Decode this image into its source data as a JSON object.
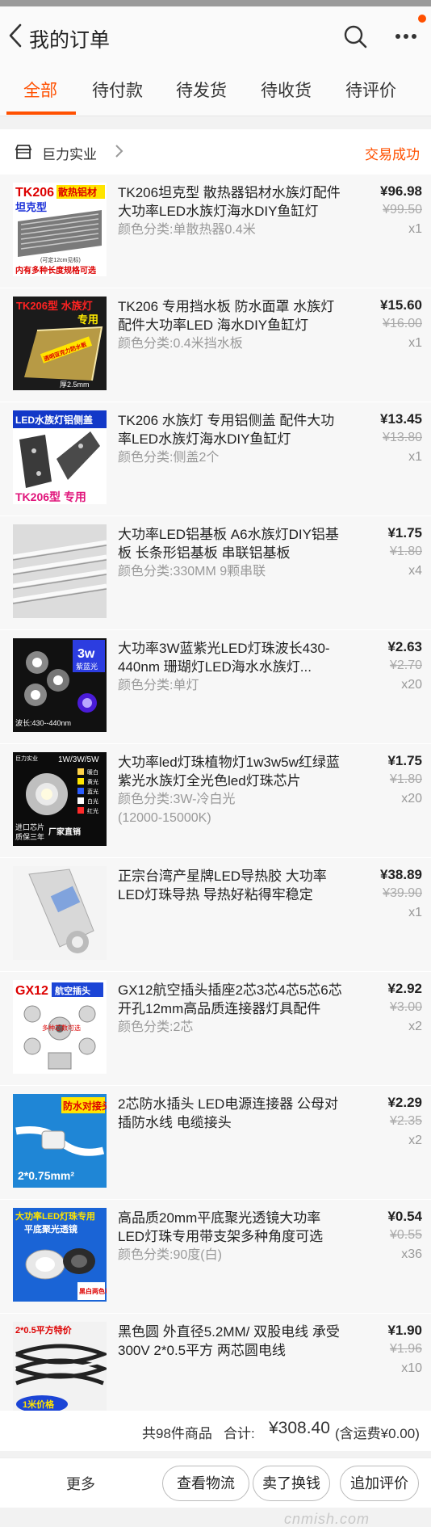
{
  "header": {
    "title": "我的订单"
  },
  "tabs": [
    {
      "label": "全部",
      "active": true
    },
    {
      "label": "待付款"
    },
    {
      "label": "待发货"
    },
    {
      "label": "待收货"
    },
    {
      "label": "待评价"
    }
  ],
  "shop": {
    "name": "巨力实业",
    "status": "交易成功"
  },
  "items": [
    {
      "name": "TK206坦克型 散热器铝材水族灯配件大功率LED水族灯海水DIY鱼缸灯",
      "spec": "颜色分类:单散热器0.4米",
      "price": "¥96.98",
      "old_price": "¥99.50",
      "qty": "x1",
      "thumb": {
        "t1": "TK206",
        "t2": "散热铝材",
        "t3": "坦克型",
        "t4": "(可定12cm见标)",
        "t5": "内有多种长度规格可选"
      }
    },
    {
      "name": "TK206 专用挡水板 防水面罩 水族灯配件大功率LED 海水DIY鱼缸灯",
      "spec": "颜色分类:0.4米挡水板",
      "price": "¥15.60",
      "old_price": "¥16.00",
      "qty": "x1",
      "thumb": {
        "t1": "TK206型 水族灯",
        "t2": "专用",
        "t3": "透明亚克力防水板",
        "t4": "厚2.5mm"
      }
    },
    {
      "name": "TK206 水族灯 专用铝侧盖 配件大功率LED水族灯海水DIY鱼缸灯",
      "spec": "颜色分类:侧盖2个",
      "price": "¥13.45",
      "old_price": "¥13.80",
      "qty": "x1",
      "thumb": {
        "t1": "LED水族灯铝侧盖",
        "t2": "TK206型 专用"
      }
    },
    {
      "name": "大功率LED铝基板 A6水族灯DIY铝基板 长条形铝基板 串联铝基板",
      "spec": "颜色分类:330MM 9颗串联",
      "price": "¥1.75",
      "old_price": "¥1.80",
      "qty": "x4",
      "thumb": {}
    },
    {
      "name": "大功率3W蓝紫光LED灯珠波长430-440nm 珊瑚灯LED海水水族灯...",
      "spec": "颜色分类:单灯",
      "price": "¥2.63",
      "old_price": "¥2.70",
      "qty": "x20",
      "thumb": {
        "t1": "3w",
        "t2": "紫蓝光",
        "t3": "波长:430--440nm"
      }
    },
    {
      "name": "大功率led灯珠植物灯1w3w5w红绿蓝紫光水族灯全光色led灯珠芯片",
      "spec": "颜色分类:3W-冷白光",
      "spec2": "(12000-15000K)",
      "price": "¥1.75",
      "old_price": "¥1.80",
      "qty": "x20",
      "thumb": {
        "t1": "巨力实业",
        "t2": "1W/3W/5W",
        "t3": "进口芯片",
        "t4": "质保三年",
        "t5": "厂家直销",
        "c1": "暖白",
        "c2": "黄光",
        "c3": "蓝光",
        "c4": "白光",
        "c5": "红光"
      }
    },
    {
      "name": "正宗台湾产星牌LED导热胶 大功率LED灯珠导热 导热好粘得牢稳定",
      "spec": "",
      "price": "¥38.89",
      "old_price": "¥39.90",
      "qty": "x1",
      "thumb": {}
    },
    {
      "name": "GX12航空插头插座2芯3芯4芯5芯6芯开孔12mm高品质连接器灯具配件",
      "spec": "颜色分类:2芯",
      "price": "¥2.92",
      "old_price": "¥3.00",
      "qty": "x2",
      "thumb": {
        "t1": "GX12",
        "t2": "航空插头",
        "t3": "多种芯数可选"
      }
    },
    {
      "name": "2芯防水插头 LED电源连接器 公母对插防水线 电缆接头",
      "spec": "",
      "price": "¥2.29",
      "old_price": "¥2.35",
      "qty": "x2",
      "thumb": {
        "t1": "防水对接头",
        "t2": "2*0.75mm²"
      }
    },
    {
      "name": "高品质20mm平底聚光透镜大功率LED灯珠专用带支架多种角度可选",
      "spec": "颜色分类:90度(白)",
      "price": "¥0.54",
      "old_price": "¥0.55",
      "qty": "x36",
      "thumb": {
        "t1": "大功率LED灯珠专用",
        "t2": "平底聚光透镜",
        "t3": "黑白两色可选"
      }
    },
    {
      "name": "黑色圆 外直径5.2MM/ 双股电线 承受300V 2*0.5平方 两芯圆电线",
      "spec": "",
      "price": "¥1.90",
      "old_price": "¥1.96",
      "qty": "x10",
      "thumb": {
        "t1": "2*0.5平方特价",
        "t2": "1米价格"
      }
    }
  ],
  "summary": {
    "count": "共98件商品",
    "total_label": "合计:",
    "total": "¥308.40",
    "shipping": "(含运费¥0.00)"
  },
  "actions": {
    "more": "更多",
    "logistics": "查看物流",
    "sell": "卖了换钱",
    "review": "追加评价"
  },
  "watermark": "cnmish.com",
  "colors": {
    "accent": "#ff5000",
    "price_text": "#222222",
    "muted": "#999999"
  },
  "icons": {
    "back": "chevron-left-icon",
    "search": "search-icon",
    "more": "more-dots-icon",
    "shop": "shop-icon",
    "arrow": "chevron-right-icon"
  }
}
